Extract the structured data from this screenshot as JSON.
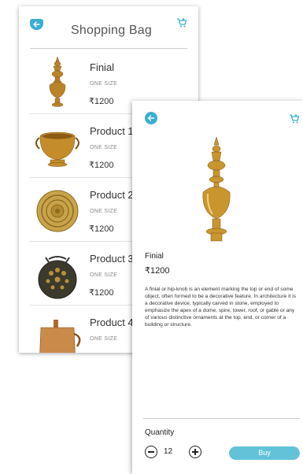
{
  "bag": {
    "title": "Shopping Bag",
    "items": [
      {
        "name": "Finial",
        "size": "ONE SIZE",
        "price": "₹1200",
        "icon": "finial-image"
      },
      {
        "name": "Product 1",
        "size": "ONE SIZE",
        "price": "₹1200",
        "icon": "brass-pot-image"
      },
      {
        "name": "Product 2",
        "size": "ONE SIZE",
        "price": "₹1200",
        "icon": "brass-plate-image"
      },
      {
        "name": "Product 3",
        "size": "ONE SIZE",
        "price": "₹1200",
        "icon": "lantern-image"
      },
      {
        "name": "Product 4",
        "size": "ONE SIZE",
        "price": "",
        "icon": "copper-vessel-image"
      }
    ]
  },
  "detail": {
    "name": "Finial",
    "price": "₹1200",
    "description": "A finial or hip-knob is an element marking the top or end of some object, often formed to be a decorative feature. In architecture it is a decorative device, typically carved in stone, employed to emphasize the apex of a dome, spire, tower, roof, or gable or any of various distinctive ornaments at the top, end, or corner of a building or structure.",
    "quantity_label": "Quantity",
    "quantity": "12",
    "buy_label": "Buy"
  },
  "colors": {
    "accent": "#3aaed6",
    "buy_button": "#62c3d8",
    "brass": "#c9962e"
  }
}
